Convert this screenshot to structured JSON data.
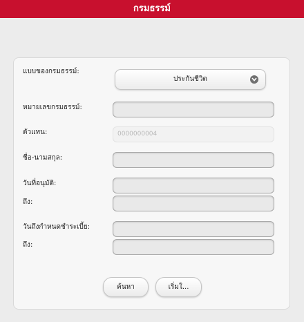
{
  "header": {
    "title": "กรมธรรม์"
  },
  "form": {
    "policy_type_label": "แบบของกรมธรรม์:",
    "policy_type_value": "ประกันชีวิต",
    "policy_number_label": "หมายเลขกรมธรรม์:",
    "agent_label": "ตัวแทน:",
    "agent_value": "0000000004",
    "name_label": "ชื่อ-นามสกุล:",
    "approval_date_label": "วันที่อนุมัติ:",
    "approval_to_label": "ถึง:",
    "due_date_label": "วันถึงกำหนดชำระเบี้ย:",
    "due_to_label": "ถึง:"
  },
  "buttons": {
    "search": "ค้นหา",
    "reset": "เริ่มใ..."
  }
}
